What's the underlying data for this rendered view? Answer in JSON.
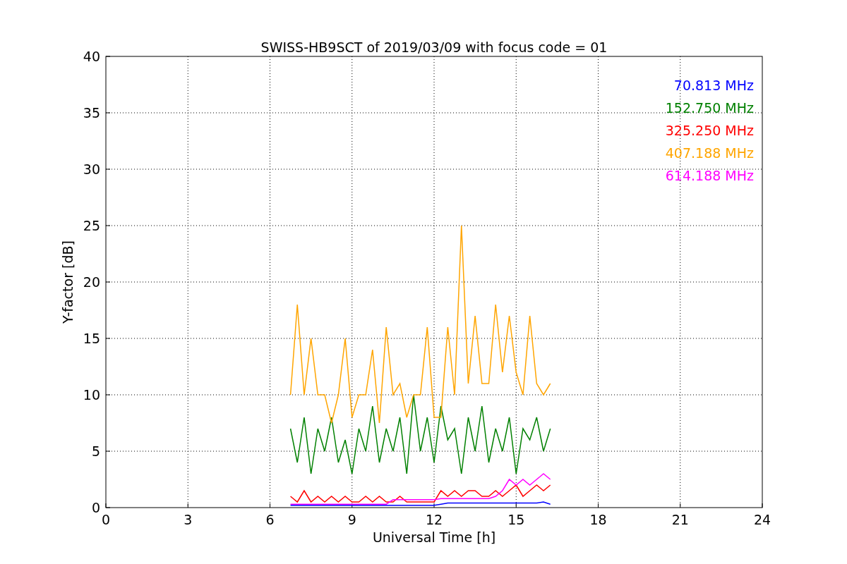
{
  "chart_data": {
    "type": "line",
    "title": "SWISS-HB9SCT of 2019/03/09 with focus code = 01",
    "xlabel": "Universal Time [h]",
    "ylabel": "Y-factor [dB]",
    "x": [
      6.75,
      7.0,
      7.25,
      7.5,
      7.75,
      8.0,
      8.25,
      8.5,
      8.75,
      9.0,
      9.25,
      9.5,
      9.75,
      10.0,
      10.25,
      10.5,
      10.75,
      11.0,
      11.25,
      11.5,
      11.75,
      12.0,
      12.25,
      12.5,
      12.75,
      13.0,
      13.25,
      13.5,
      13.75,
      14.0,
      14.25,
      14.5,
      14.75,
      15.0,
      15.25,
      15.5,
      15.75,
      16.0,
      16.25
    ],
    "series": [
      {
        "name": "70.813 MHz",
        "color": "#0000ff",
        "values": [
          0.2,
          0.2,
          0.2,
          0.2,
          0.2,
          0.2,
          0.2,
          0.2,
          0.2,
          0.2,
          0.2,
          0.2,
          0.2,
          0.2,
          0.2,
          0.2,
          0.2,
          0.2,
          0.2,
          0.2,
          0.2,
          0.2,
          0.3,
          0.4,
          0.4,
          0.4,
          0.4,
          0.4,
          0.4,
          0.4,
          0.4,
          0.4,
          0.4,
          0.4,
          0.4,
          0.4,
          0.4,
          0.5,
          0.3
        ]
      },
      {
        "name": "152.750 MHz",
        "color": "#008000",
        "values": [
          7,
          4,
          8,
          3,
          7,
          5,
          8,
          4,
          6,
          3,
          7,
          5,
          9,
          4,
          7,
          5,
          8,
          3,
          10,
          5,
          8,
          4,
          9,
          6,
          7,
          3,
          8,
          5,
          9,
          4,
          7,
          5,
          8,
          3,
          7,
          6,
          8,
          5,
          7
        ]
      },
      {
        "name": "325.250 MHz",
        "color": "#ff0000",
        "values": [
          1,
          0.5,
          1.5,
          0.5,
          1,
          0.5,
          1,
          0.5,
          1,
          0.5,
          0.5,
          1,
          0.5,
          1,
          0.5,
          0.5,
          1,
          0.5,
          0.5,
          0.5,
          0.5,
          0.5,
          1.5,
          1,
          1.5,
          1,
          1.5,
          1.5,
          1,
          1,
          1.5,
          1,
          1.5,
          2,
          1,
          1.5,
          2,
          1.5,
          2
        ]
      },
      {
        "name": "407.188 MHz",
        "color": "#ffa500",
        "values": [
          10,
          18,
          10,
          15,
          10,
          10,
          7.5,
          10,
          15,
          8,
          10,
          10,
          14,
          7.5,
          16,
          10,
          11,
          8,
          10,
          10,
          16,
          8,
          8,
          16,
          10,
          25,
          11,
          17,
          11,
          11,
          18,
          12,
          17,
          12,
          10,
          17,
          11,
          10,
          11
        ]
      },
      {
        "name": "614.188 MHz",
        "color": "#ff00ff",
        "values": [
          0.3,
          0.3,
          0.3,
          0.3,
          0.3,
          0.3,
          0.3,
          0.3,
          0.3,
          0.3,
          0.3,
          0.3,
          0.3,
          0.3,
          0.3,
          0.7,
          0.7,
          0.7,
          0.7,
          0.7,
          0.7,
          0.7,
          0.8,
          0.8,
          0.8,
          0.8,
          0.8,
          0.8,
          0.8,
          0.8,
          1,
          1.5,
          2.5,
          2,
          2.5,
          2,
          2.5,
          3,
          2.5
        ]
      }
    ],
    "grid": true,
    "xlim": [
      0,
      24
    ],
    "ylim": [
      0,
      40
    ],
    "xticks": [
      0,
      3,
      6,
      9,
      12,
      15,
      18,
      21,
      24
    ],
    "yticks": [
      0,
      5,
      10,
      15,
      20,
      25,
      30,
      35,
      40
    ]
  }
}
